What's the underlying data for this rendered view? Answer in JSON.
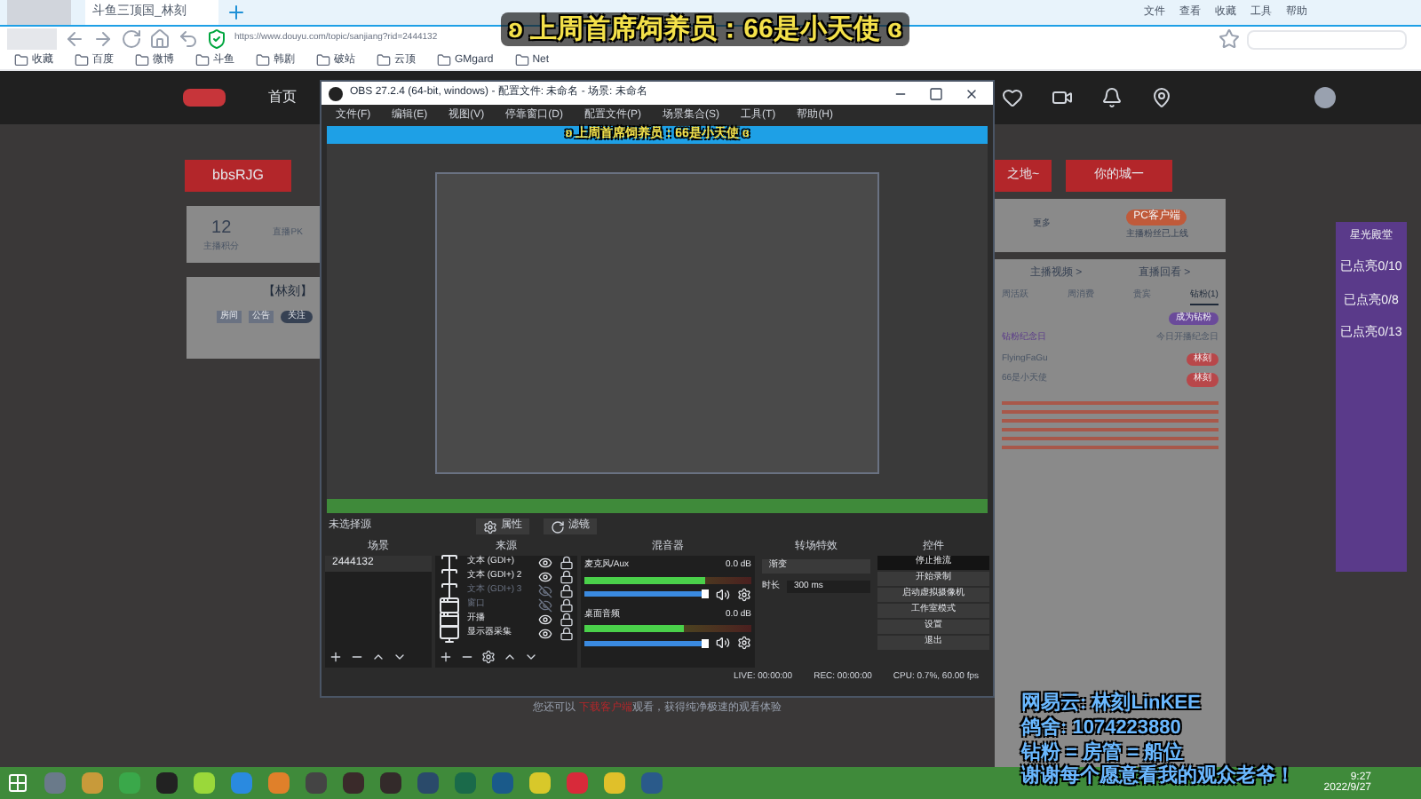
{
  "browser": {
    "tab_title": "斗鱼三顶国_林刻",
    "url": "https://www.douyu.com/topic/sanjiang?rid=2444132",
    "menu": [
      "文件",
      "查看",
      "收藏",
      "工具",
      "帮助"
    ],
    "bookmarks": [
      "收藏",
      "百度",
      "微博",
      "斗鱼",
      "韩剧",
      "破站",
      "云顶",
      "GMgard",
      "Net"
    ]
  },
  "overlay_top": "ʚ 上周首席饲养员：66是小天使 ɞ",
  "site": {
    "nav_home": "首页",
    "banner_buttons": [
      "bbsRJG",
      "之地~",
      "你的城一"
    ],
    "points_card": {
      "value": "12",
      "label": "主播积分",
      "pk_label": "直播PK"
    },
    "streamer_card": {
      "name": "【林刻】",
      "room_button": "房间",
      "notice_button": "公告",
      "follow_button": "关注"
    },
    "promo": {
      "before": "您还可以 ",
      "link": "下载客户端",
      "after": "观看，获得纯净极速的观看体验"
    },
    "right": {
      "more": "更多",
      "client_button": "PC客户端",
      "client_note": "主播粉丝已上线",
      "links": [
        "主播视频 >",
        "直播回看 >"
      ],
      "tabs": [
        {
          "label": "周活跃",
          "selected": false
        },
        {
          "label": "周消费",
          "selected": false
        },
        {
          "label": "贵宾",
          "selected": false
        },
        {
          "label": "钻粉(1)",
          "selected": true
        }
      ],
      "fan_button": "成为钻粉",
      "anniversary": "钻粉纪念日",
      "today": "今日开播纪念日",
      "fans": [
        {
          "name": "FlyingFaGu",
          "badge": "林刻"
        },
        {
          "name": "66是小天使",
          "badge": "林刻"
        }
      ]
    },
    "sidebar": {
      "title": "星光殿堂",
      "items": [
        "已点亮0/10",
        "已点亮0/8",
        "已点亮0/13"
      ]
    }
  },
  "obs": {
    "title": "OBS 27.2.4 (64-bit, windows) - 配置文件: 未命名 - 场景: 未命名",
    "menu": [
      "文件(F)",
      "编辑(E)",
      "视图(V)",
      "停靠窗口(D)",
      "配置文件(P)",
      "场景集合(S)",
      "工具(T)",
      "帮助(H)"
    ],
    "preview_overlay": "ʚ 上周首席饲养员：66是小天使 ɞ",
    "no_source": "未选择源",
    "source_buttons": [
      "属性",
      "滤镜"
    ],
    "docks": [
      "场景",
      "来源",
      "混音器",
      "转场特效",
      "控件"
    ],
    "scenes": [
      {
        "name": "2444132",
        "selected": true
      }
    ],
    "sources": [
      {
        "kind": "text",
        "name": "文本 (GDI+)",
        "visible": true
      },
      {
        "kind": "text",
        "name": "文本 (GDI+) 2",
        "visible": true
      },
      {
        "kind": "text",
        "name": "文本 (GDI+) 3",
        "visible": false
      },
      {
        "kind": "window",
        "name": "窗口",
        "visible": false
      },
      {
        "kind": "window",
        "name": "开播",
        "visible": true
      },
      {
        "kind": "display",
        "name": "显示器采集",
        "visible": true
      }
    ],
    "mixer": [
      {
        "name": "麦克风/Aux",
        "reading": "0.0 dB",
        "level": 0.72,
        "fader": {
          "level": 1
        }
      },
      {
        "name": "桌面音频",
        "reading": "0.0 dB",
        "level": 0.6,
        "fader": {
          "level": 1
        }
      }
    ],
    "transition": {
      "type": "渐变",
      "duration_label": "时长",
      "duration": "300 ms"
    },
    "controls": [
      {
        "label": "停止推流",
        "active": true
      },
      {
        "label": "开始录制",
        "active": false
      },
      {
        "label": "启动虚拟摄像机",
        "active": false
      },
      {
        "label": "工作室模式",
        "active": false
      },
      {
        "label": "设置",
        "active": false
      },
      {
        "label": "退出",
        "active": false
      }
    ],
    "status": {
      "live": "LIVE: 00:00:00",
      "rec": "REC: 00:00:00",
      "cpu": "CPU: 0.7%, 60.00 fps"
    }
  },
  "overlay_bottom": [
    "网易云: 林刻LinKEE",
    "鸽舍: 1074223880",
    "钻粉 = 房管 = 船位",
    "谢谢每个愿意看我的观众老爷！"
  ],
  "taskbar": {
    "time": "9:27",
    "date": "2022/9/27"
  }
}
